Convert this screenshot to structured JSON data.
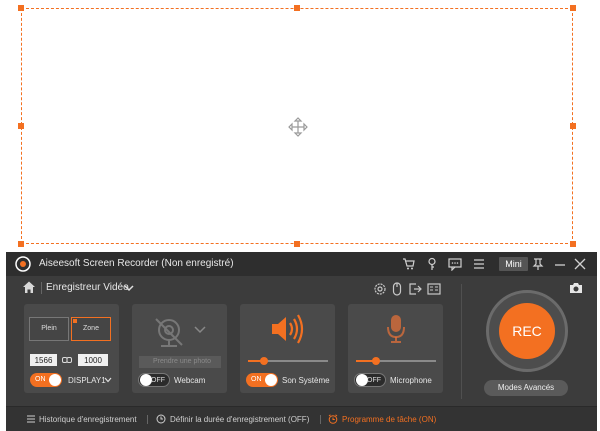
{
  "window": {
    "title": "Aiseesoft Screen Recorder (Non enregistré)",
    "mini_label": "Mini",
    "icons": [
      "cart-icon",
      "key-icon",
      "chat-icon",
      "menu-icon",
      "pin-icon",
      "minimize-icon",
      "close-icon"
    ]
  },
  "nav": {
    "title": "Enregistreur Vidéo",
    "icons": [
      "settings-icon",
      "mouse-icon",
      "export-icon",
      "display-icon"
    ]
  },
  "display_panel": {
    "full_label": "Plein",
    "zone_label": "Zone",
    "width": "1566",
    "height": "1000",
    "toggle_state": "ON",
    "display_name": "DISPLAY1"
  },
  "webcam_panel": {
    "preview_label": "Prendre une photo",
    "toggle_state": "OFF",
    "label": "Webcam"
  },
  "system_sound_panel": {
    "toggle_state": "ON",
    "label": "Son Système",
    "volume": 0.2
  },
  "microphone_panel": {
    "toggle_state": "OFF",
    "label": "Microphone",
    "volume": 0.25
  },
  "record": {
    "rec_label": "REC",
    "advanced_label": "Modes Avancés"
  },
  "status": {
    "history": "Historique d'enregistrement",
    "duration": "Définir la durée d'enregistrement (OFF)",
    "schedule": "Programme de tâche (ON)"
  },
  "colors": {
    "accent": "#f37021",
    "window_bg": "#3c3c3c",
    "panel_bg": "#4a4a4a"
  }
}
